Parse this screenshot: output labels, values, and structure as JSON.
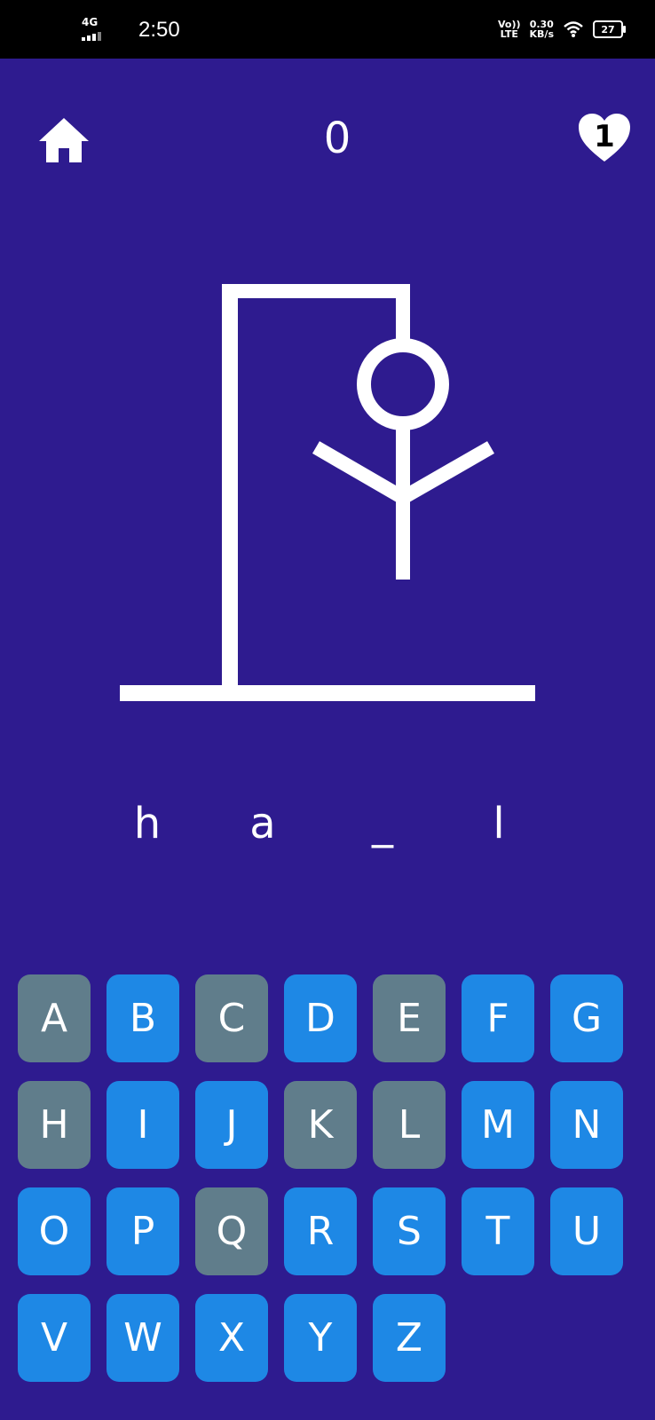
{
  "status_bar": {
    "network": "4G",
    "time": "2:50",
    "volte_top": "Vo))",
    "volte_bottom": "LTE",
    "speed_value": "0.30",
    "speed_unit": "KB/s",
    "battery": "27"
  },
  "header": {
    "score": "0",
    "lives": "1",
    "home_icon": "home-icon",
    "lives_icon": "heart-icon"
  },
  "hangman": {
    "parts_drawn": [
      "base",
      "pole",
      "beam",
      "rope",
      "head",
      "body",
      "left-arm",
      "right-arm"
    ]
  },
  "word": {
    "slots": [
      "h",
      "a",
      "_",
      "l"
    ]
  },
  "keyboard": {
    "keys": [
      {
        "label": "A",
        "used": true
      },
      {
        "label": "B",
        "used": false
      },
      {
        "label": "C",
        "used": true
      },
      {
        "label": "D",
        "used": false
      },
      {
        "label": "E",
        "used": true
      },
      {
        "label": "F",
        "used": false
      },
      {
        "label": "G",
        "used": false
      },
      {
        "label": "H",
        "used": true
      },
      {
        "label": "I",
        "used": false
      },
      {
        "label": "J",
        "used": false
      },
      {
        "label": "K",
        "used": true
      },
      {
        "label": "L",
        "used": true
      },
      {
        "label": "M",
        "used": false
      },
      {
        "label": "N",
        "used": false
      },
      {
        "label": "O",
        "used": false
      },
      {
        "label": "P",
        "used": false
      },
      {
        "label": "Q",
        "used": true
      },
      {
        "label": "R",
        "used": false
      },
      {
        "label": "S",
        "used": false
      },
      {
        "label": "T",
        "used": false
      },
      {
        "label": "U",
        "used": false
      },
      {
        "label": "V",
        "used": false
      },
      {
        "label": "W",
        "used": false
      },
      {
        "label": "X",
        "used": false
      },
      {
        "label": "Y",
        "used": false
      },
      {
        "label": "Z",
        "used": false
      }
    ]
  },
  "colors": {
    "background": "#2e1b8f",
    "key_active": "#1e88e5",
    "key_used": "#607d8b",
    "ink": "#ffffff"
  }
}
